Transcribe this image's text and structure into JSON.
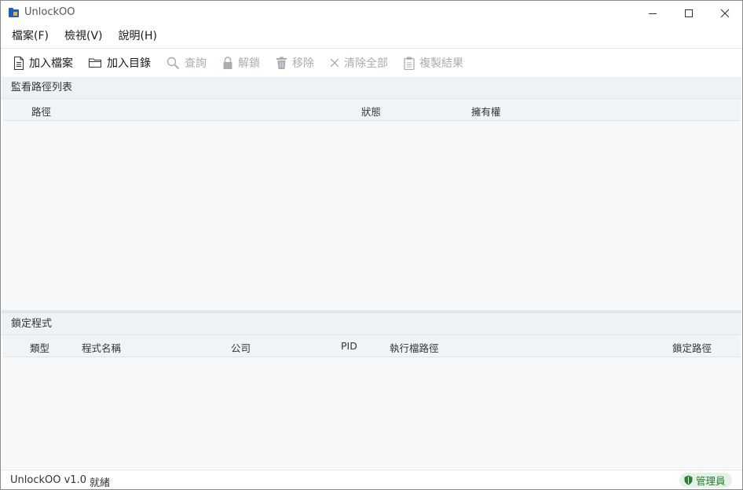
{
  "window": {
    "title": "UnlockOO"
  },
  "menu": {
    "file": "檔案(F)",
    "view": "檢視(V)",
    "help": "說明(H)"
  },
  "toolbar": {
    "add_file": "加入檔案",
    "add_folder": "加入目錄",
    "query": "查詢",
    "unlock": "解鎖",
    "remove": "移除",
    "clear_all": "清除全部",
    "copy_results": "複製結果"
  },
  "watch_panel": {
    "title": "監看路徑列表",
    "columns": [
      "路徑",
      "狀態",
      "擁有權"
    ]
  },
  "lock_panel": {
    "title": "鎖定程式",
    "columns": [
      "類型",
      "程式名稱",
      "公司",
      "PID",
      "執行檔路徑",
      "鎖定路徑"
    ]
  },
  "status": {
    "version": "UnlockOO v1.0",
    "text": "就緒",
    "badge": "管理員"
  },
  "colors": {
    "disabled_text": "#a7adb4",
    "panel_bg": "#f6f8fa",
    "admin_badge_bg": "#e3f2e6",
    "admin_badge_text": "#2e7d32"
  }
}
